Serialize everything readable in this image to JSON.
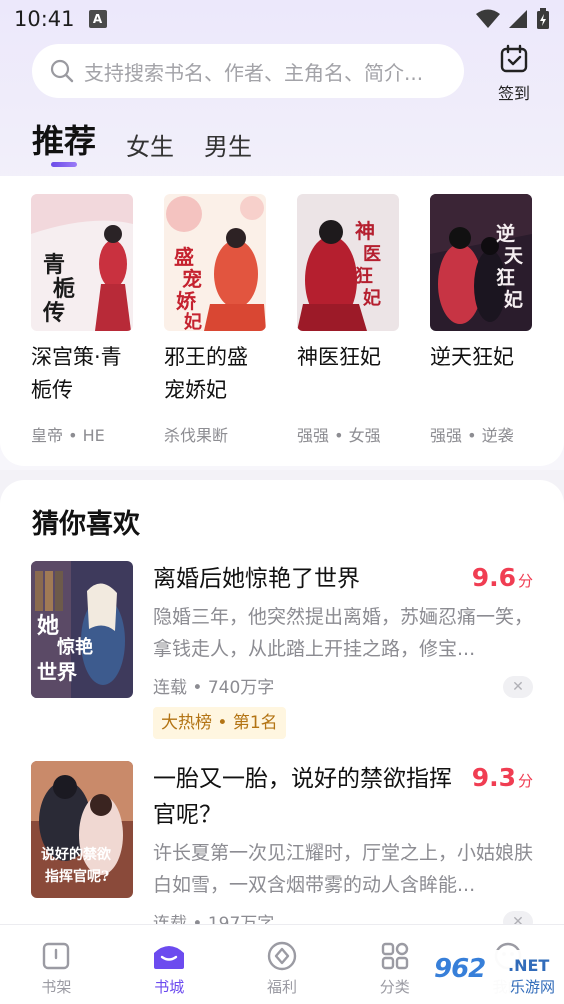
{
  "status_bar": {
    "time": "10:41",
    "notif_letter": "A"
  },
  "search": {
    "placeholder": "支持搜索书名、作者、主角名、简介..."
  },
  "checkin": {
    "label": "签到"
  },
  "tabs": [
    {
      "label": "推荐",
      "active": true
    },
    {
      "label": "女生",
      "active": false
    },
    {
      "label": "男生",
      "active": false
    }
  ],
  "recommend": [
    {
      "title": "深宫策·青栀传",
      "tags": "皇帝 • HE",
      "cover_text": "青栀传",
      "cover_colors": [
        "#f5eef0",
        "#c0313f"
      ]
    },
    {
      "title": "邪王的盛宠娇妃",
      "tags": "杀伐果断",
      "cover_text": "盛宠娇妃",
      "cover_colors": [
        "#fbeee6",
        "#d94b3c"
      ]
    },
    {
      "title": "神医狂妃",
      "tags": "强强 • 女强",
      "cover_text": "神医狂妃",
      "cover_colors": [
        "#eae3e6",
        "#b51f2f"
      ]
    },
    {
      "title": "逆天狂妃",
      "tags": "强强 • 逆袭",
      "cover_text": "逆天狂妃",
      "cover_colors": [
        "#2a1b2e",
        "#d23a4a"
      ]
    }
  ],
  "guess": {
    "title": "猜你喜欢",
    "books": [
      {
        "title": "离婚后她惊艳了世界",
        "score": "9.6",
        "score_unit": "分",
        "desc": "隐婚三年，他突然提出离婚，苏婳忍痛一笑，拿钱走人，从此踏上开挂之路，修宝...",
        "meta": "连载 • 740万字",
        "badge": "大热榜 • 第1名",
        "cover_text": "她惊艳世界"
      },
      {
        "title": "一胎又一胎，说好的禁欲指挥官呢？",
        "score": "9.3",
        "score_unit": "分",
        "desc": "许长夏第一次见江耀时，厅堂之上，小姑娘肤白如雪，一双含烟带雾的动人含眸能...",
        "meta": "连载 • 197万字",
        "cover_text": "说好的禁欲指挥官呢？"
      }
    ]
  },
  "nav": [
    {
      "label": "书架",
      "active": false
    },
    {
      "label": "书城",
      "active": true
    },
    {
      "label": "福利",
      "active": false
    },
    {
      "label": "分类",
      "active": false
    },
    {
      "label": "我的",
      "active": false
    }
  ],
  "watermark": {
    "logo": "962",
    "net": ".NET",
    "sub": "乐游网"
  },
  "colors": {
    "accent": "#6c4bef",
    "score": "#f03d52"
  }
}
